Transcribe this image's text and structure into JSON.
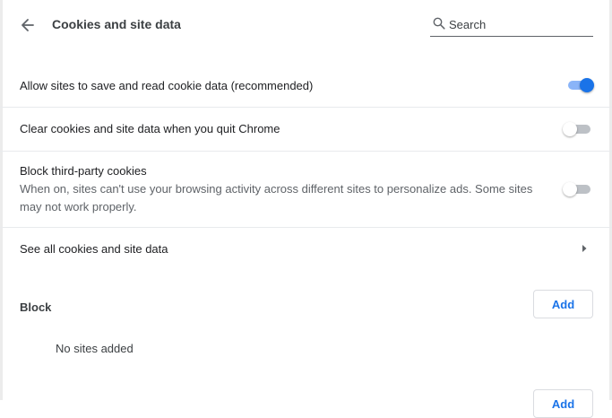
{
  "header": {
    "title": "Cookies and site data",
    "back_icon": "arrow-back-icon",
    "search_icon": "search-icon",
    "search_placeholder": "Search"
  },
  "settings": [
    {
      "label": "Allow sites to save and read cookie data (recommended)",
      "enabled": true
    },
    {
      "label": "Clear cookies and site data when you quit Chrome",
      "enabled": false
    },
    {
      "label": "Block third-party cookies",
      "sublabel": "When on, sites can't use your browsing activity across different sites to personalize ads. Some sites may not work properly.",
      "enabled": false
    }
  ],
  "see_all": {
    "label": "See all cookies and site data",
    "icon": "arrow-right-icon"
  },
  "block_section": {
    "title": "Block",
    "add_label": "Add",
    "empty_text": "No sites added"
  },
  "second_section": {
    "add_label": "Add"
  },
  "colors": {
    "accent": "#1a73e8",
    "toggle_track_on": "#8ab4f8",
    "divider": "#e8eaed"
  }
}
